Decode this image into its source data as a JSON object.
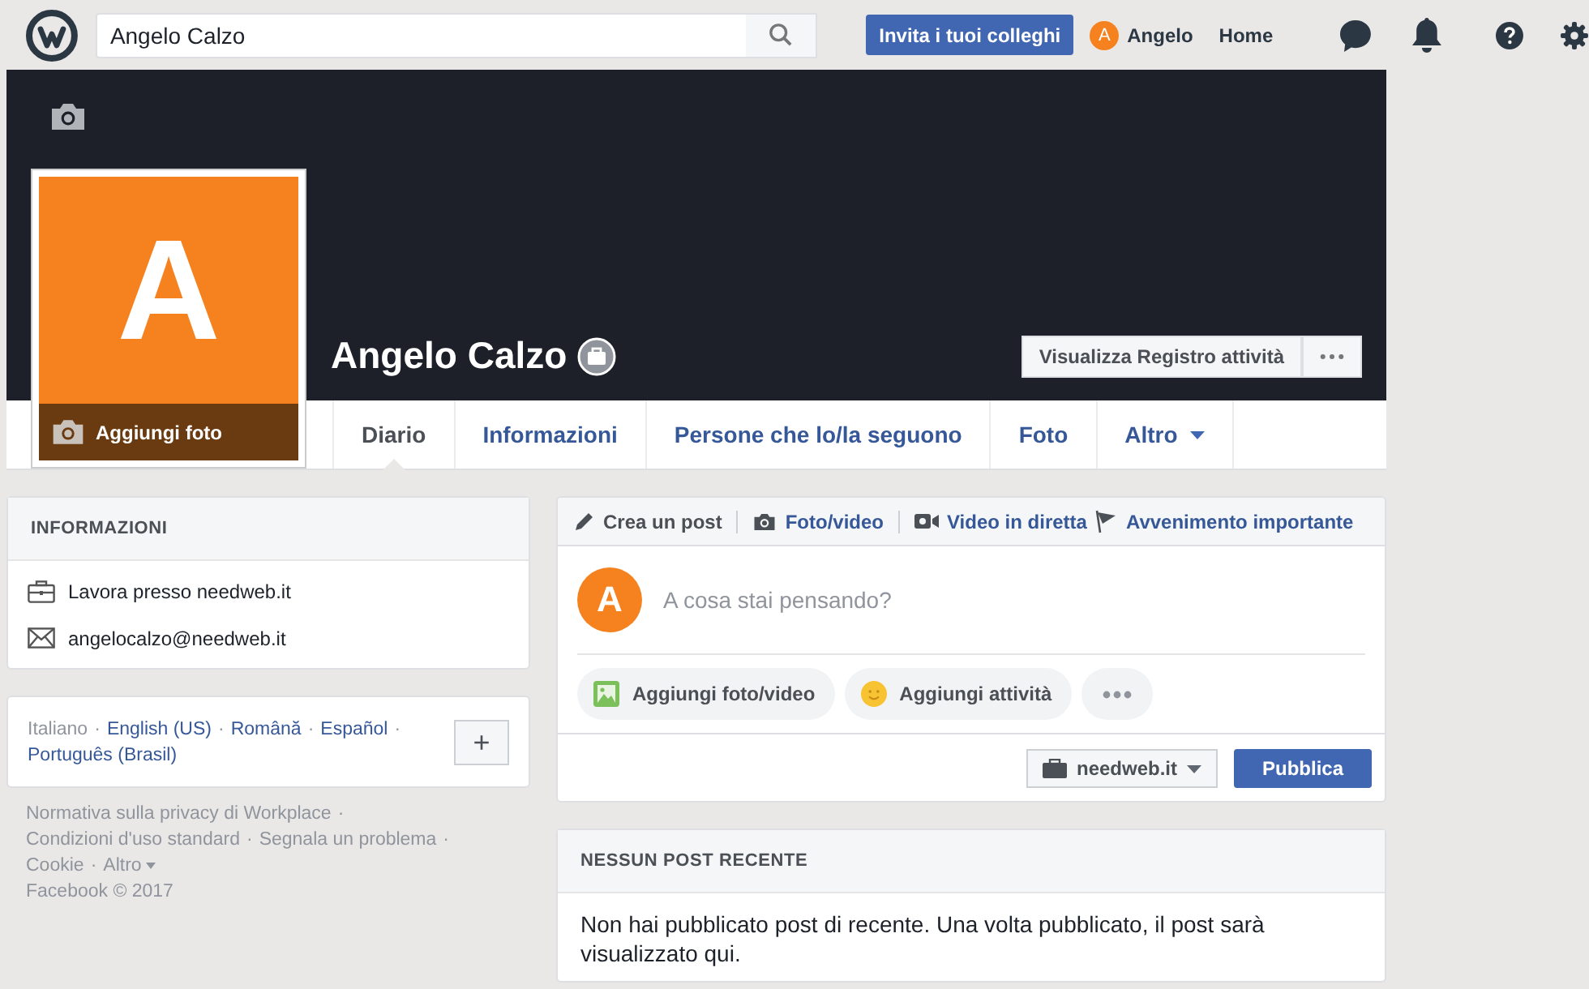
{
  "topbar": {
    "search": {
      "value": "Angelo Calzo"
    },
    "invite_button": "Invita i tuoi colleghi",
    "user": {
      "initial": "A",
      "name": "Angelo"
    },
    "home": "Home"
  },
  "profile": {
    "name": "Angelo Calzo",
    "avatar_initial": "A",
    "add_photo": "Aggiungi foto",
    "activity_button": "Visualizza Registro attività"
  },
  "tabs": [
    {
      "label": "Diario",
      "selected": true,
      "dropdown": false
    },
    {
      "label": "Informazioni",
      "selected": false,
      "dropdown": false
    },
    {
      "label": "Persone che lo/la seguono",
      "selected": false,
      "dropdown": false
    },
    {
      "label": "Foto",
      "selected": false,
      "dropdown": false
    },
    {
      "label": "Altro",
      "selected": false,
      "dropdown": true
    }
  ],
  "info": {
    "title": "INFORMAZIONI",
    "items": [
      {
        "kind": "work",
        "text": "Lavora presso needweb.it"
      },
      {
        "kind": "email",
        "text": "angelocalzo@needweb.it"
      }
    ]
  },
  "languages": {
    "separator": "·",
    "items": [
      {
        "label": "Italiano",
        "selected": true
      },
      {
        "label": "English (US)",
        "selected": false
      },
      {
        "label": "Română",
        "selected": false
      },
      {
        "label": "Español",
        "selected": false
      },
      {
        "label": "Português (Brasil)",
        "selected": false
      }
    ],
    "add": "+"
  },
  "footer": {
    "separator": "·",
    "links": [
      "Normativa sulla privacy di Workplace",
      "Condizioni d'uso standard",
      "Segnala un problema",
      "Cookie",
      "Altro"
    ],
    "copyright": "Facebook © 2017"
  },
  "composer": {
    "actions": [
      {
        "kind": "post",
        "label": "Crea un post",
        "selected": true
      },
      {
        "label": "Foto/video",
        "selected": false
      },
      {
        "kind": "live",
        "label": "Video in diretta",
        "selected": false
      },
      {
        "kind": "event",
        "label": "Avvenimento importante",
        "selected": false
      }
    ],
    "avatar_initial": "A",
    "placeholder": "A cosa stai pensando?",
    "attachments": [
      {
        "label": "Aggiungi foto/video"
      },
      {
        "kind": "activity",
        "label": "Aggiungi attività"
      },
      {
        "kind": "more"
      }
    ],
    "audience": "needweb.it",
    "publish": "Pubblica"
  },
  "recent": {
    "title": "NESSUN POST RECENTE",
    "text": "Non hai pubblicato post di recente. Una volta pubblicato, il post sarà visualizzato qui."
  }
}
